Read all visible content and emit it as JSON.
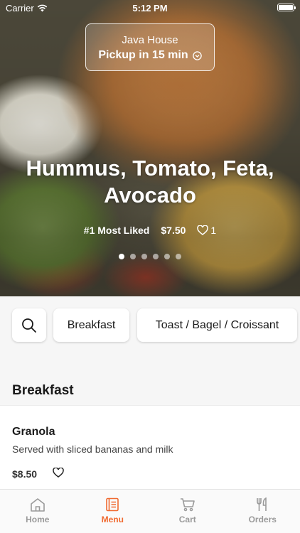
{
  "status_bar": {
    "carrier": "Carrier",
    "time": "5:12 PM",
    "battery_level": 1.0
  },
  "pickup": {
    "store": "Java House",
    "time_label": "Pickup in 15 min"
  },
  "hero": {
    "title_line1": "Hummus, Tomato, Feta,",
    "title_line2": "Avocado",
    "rank": "#1 Most Liked",
    "price": "$7.50",
    "likes": "1",
    "carousel": {
      "count": 6,
      "active_index": 0
    }
  },
  "categories": [
    "Breakfast",
    "Toast / Bagel / Croissant"
  ],
  "section": {
    "title": "Breakfast"
  },
  "items": [
    {
      "name": "Granola",
      "description": "Served with sliced bananas and milk",
      "price": "$8.50"
    }
  ],
  "tabs": [
    {
      "label": "Home",
      "icon": "home-icon",
      "active": false
    },
    {
      "label": "Menu",
      "icon": "menu-book-icon",
      "active": true
    },
    {
      "label": "Cart",
      "icon": "cart-icon",
      "active": false
    },
    {
      "label": "Orders",
      "icon": "utensils-icon",
      "active": false
    }
  ],
  "colors": {
    "accent": "#f06a30",
    "inactive": "#9a9a9a"
  }
}
